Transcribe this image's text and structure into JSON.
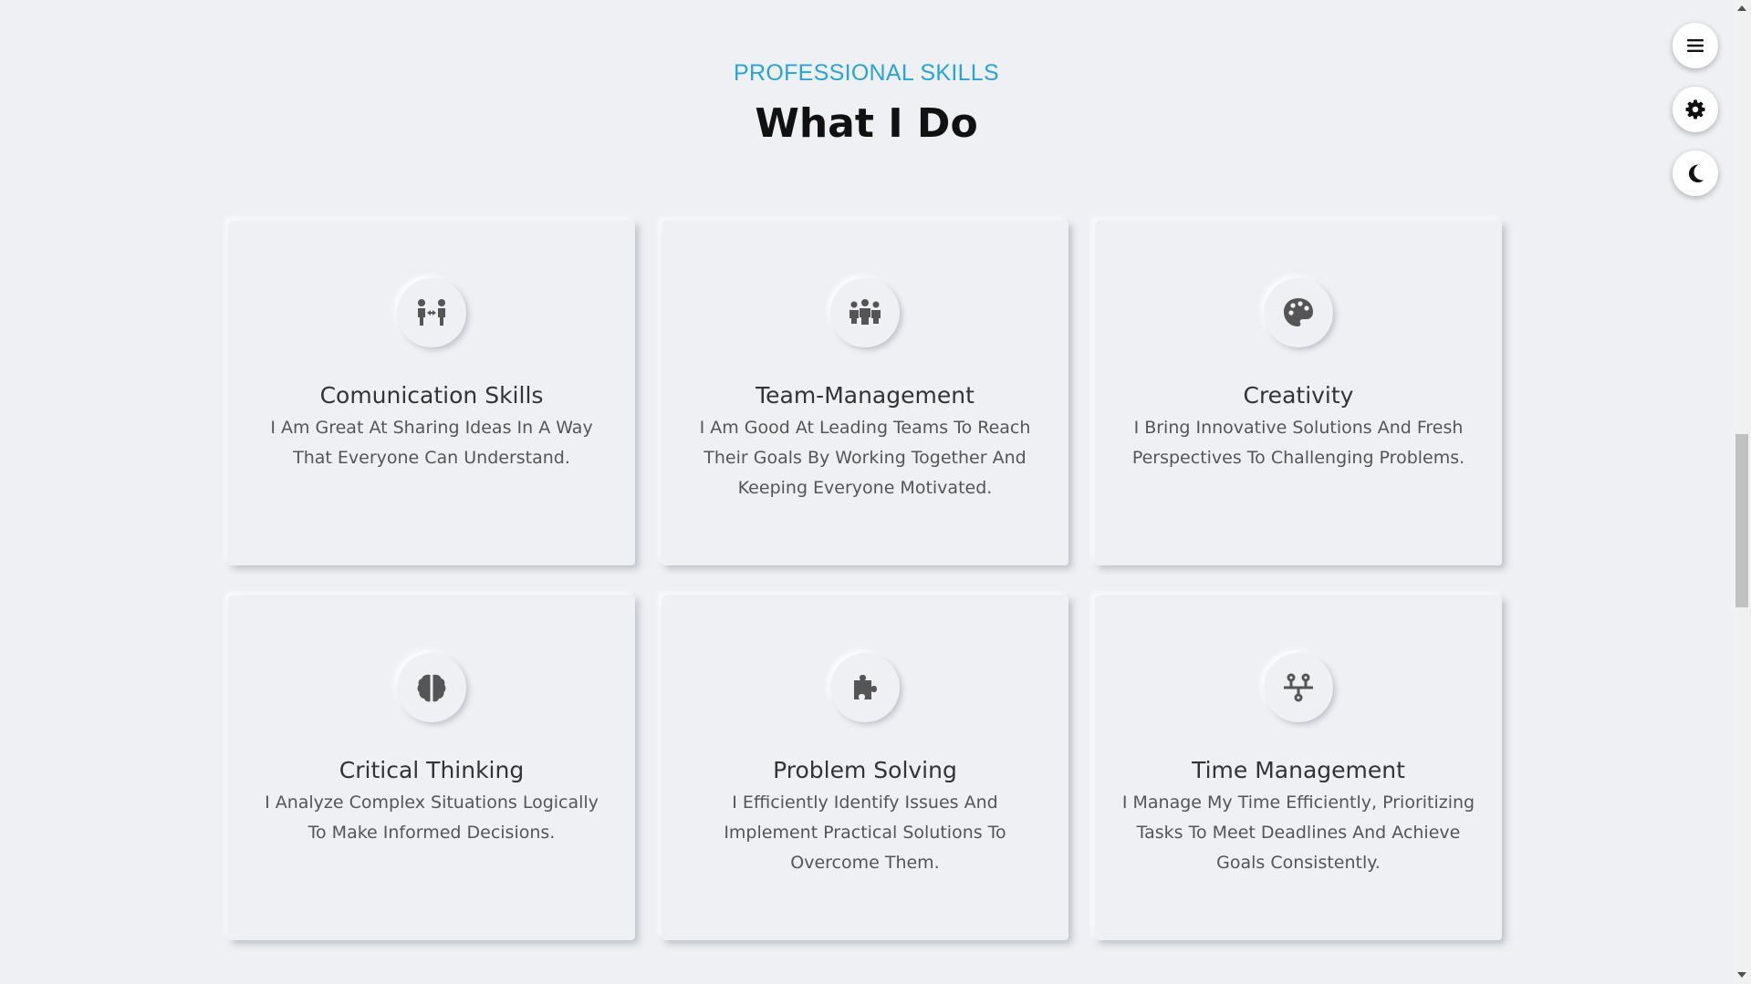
{
  "section": {
    "eyebrow": "PROFESSIONAL SKILLS",
    "title": "What I Do"
  },
  "skills": [
    {
      "icon": "people-arrows-icon",
      "title": "Comunication Skills",
      "description": "I Am Great At Sharing Ideas In A Way That Everyone Can Understand."
    },
    {
      "icon": "people-group-icon",
      "title": "Team-Management",
      "description": "I Am Good At Leading Teams To Reach Their Goals By Working Together And Keeping Everyone Motivated."
    },
    {
      "icon": "palette-icon",
      "title": "Creativity",
      "description": "I Bring Innovative Solutions And Fresh Perspectives To Challenging Problems."
    },
    {
      "icon": "brain-icon",
      "title": "Critical Thinking",
      "description": "I Analyze Complex Situations Logically To Make Informed Decisions."
    },
    {
      "icon": "puzzle-piece-icon",
      "title": "Problem Solving",
      "description": "I Efficiently Identify Issues And Implement Practical Solutions To Overcome Them."
    },
    {
      "icon": "timeline-icon",
      "title": "Time Management",
      "description": "I Manage My Time Efficiently, Prioritizing Tasks To Meet Deadlines And Achieve Goals Consistently."
    }
  ],
  "sidebar": {
    "buttons": [
      {
        "icon": "hamburger-menu-icon"
      },
      {
        "icon": "gear-icon"
      },
      {
        "icon": "moon-icon"
      }
    ]
  },
  "colors": {
    "background": "#eef0f4",
    "accent": "#27a4de",
    "icon": "#555555"
  }
}
